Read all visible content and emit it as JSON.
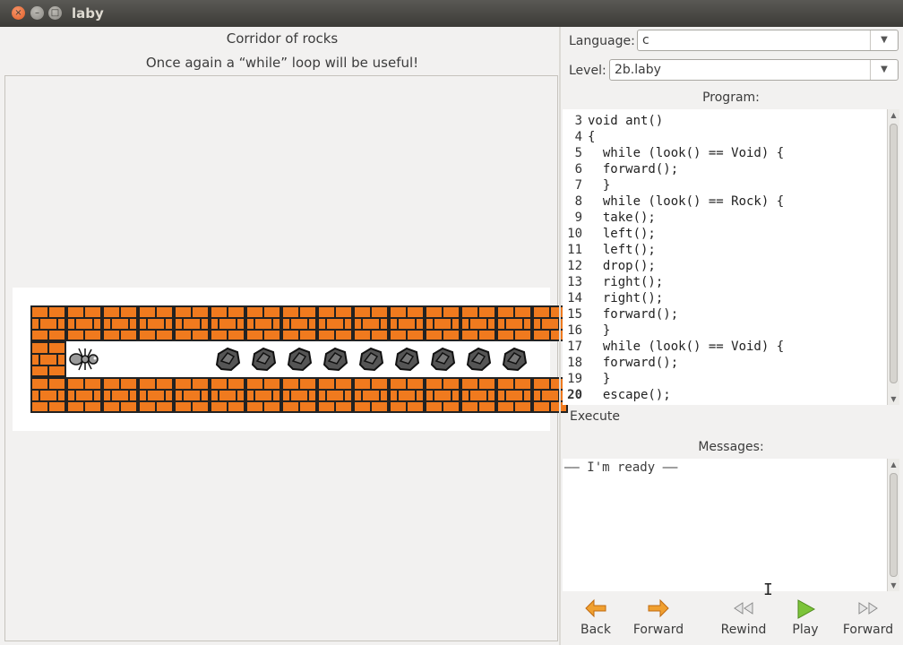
{
  "window": {
    "title": "laby",
    "close_glyph": "×",
    "min_glyph": "–",
    "max_glyph": "□"
  },
  "level": {
    "title": "Corridor of rocks",
    "description": "Once again a “while” loop will be useful!"
  },
  "map": {
    "rows": [
      "wwwwwwwwwwwwwww",
      "wa...rrrrrrrrr.x",
      "wwwwwwwwwwwwwww"
    ],
    "legend": {
      "w": "brick-wall",
      "a": "ant",
      "r": "rock",
      "x": "exit-door",
      ".": "empty"
    },
    "colors": {
      "brick": "#f07a1e",
      "mortar": "#222222",
      "rock": "#555555",
      "door": "#d9646a"
    }
  },
  "settings": {
    "language_label": "Language:",
    "language_value": "c",
    "level_label": "Level:",
    "level_value": "2b.laby"
  },
  "program": {
    "title": "Program:",
    "line_numbers": [
      "3",
      "4",
      "5",
      "6",
      "7",
      "8",
      "9",
      "10",
      "11",
      "12",
      "13",
      "14",
      "15",
      "16",
      "17",
      "18",
      "19",
      "20"
    ],
    "current_line": "20",
    "lines": [
      "void ant()",
      "{",
      "  while (look() == Void) {",
      "  forward();",
      "  }",
      "  while (look() == Rock) {",
      "  take();",
      "  left();",
      "  left();",
      "  drop();",
      "  right();",
      "  right();",
      "  forward();",
      "  }",
      "  while (look() == Void) {",
      "  forward();",
      "  }",
      "  escape();"
    ]
  },
  "execute_label": "Execute",
  "messages": {
    "title": "Messages:",
    "text": "—— I'm ready ——"
  },
  "toolbar": {
    "back": "Back",
    "forward": "Forward",
    "rewind": "Rewind",
    "play": "Play",
    "step_forward": "Forward"
  },
  "accent_colors": {
    "arrow_orange": "#f0a030",
    "play_green": "#7cc43a"
  }
}
